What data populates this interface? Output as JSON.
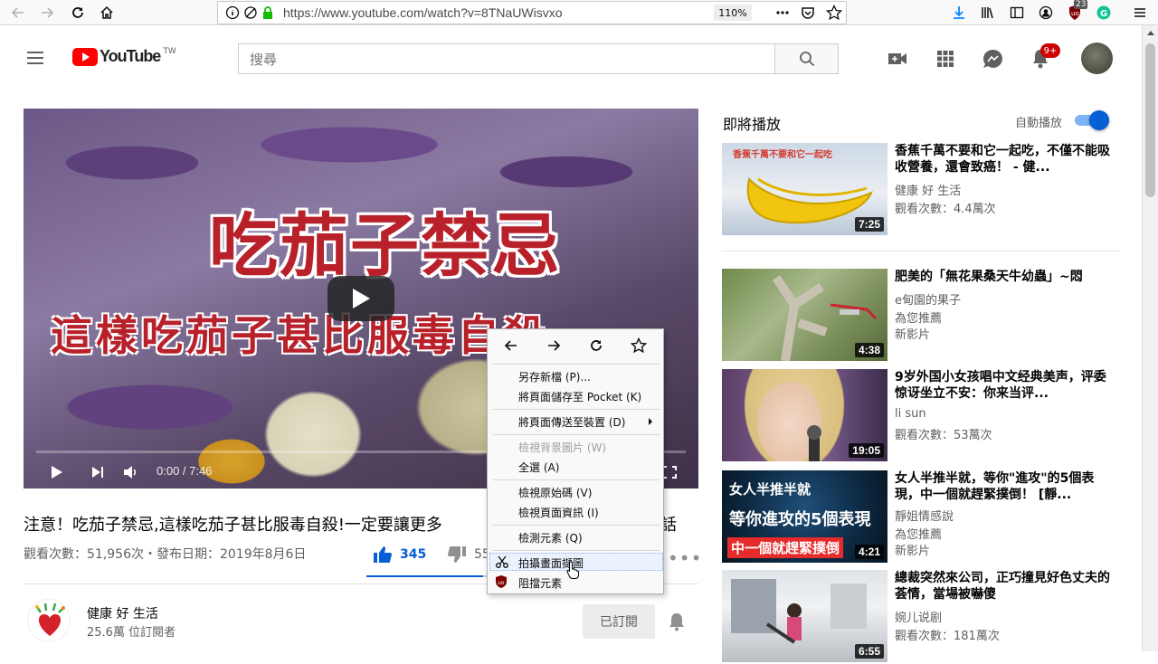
{
  "browser": {
    "url": "https://www.youtube.com/watch?v=8TNaUWisvxo",
    "zoom": "110%",
    "extension_badge": "23"
  },
  "header": {
    "logo_text": "YouTube",
    "logo_region": "TW",
    "search_placeholder": "搜尋",
    "notification_count": "9+"
  },
  "video": {
    "art_title": "吃茄子禁忌",
    "art_subtitle": "這樣吃茄子甚比服毒自殺",
    "time": "0:00 / 7:46",
    "title": "注意！吃茄子禁忌,這樣吃茄子甚比服毒自殺!一定要讓更多",
    "title_tail": "話",
    "meta": "觀看次數：51,956次・發布日期：2019年8月6日",
    "likes": "345",
    "dislikes": "55",
    "like_ratio": 0.86
  },
  "channel": {
    "name": "健康 好 生活",
    "subscribers": "25.6萬 位訂閱者",
    "subscribe_label": "已訂閱"
  },
  "sidebar": {
    "up_next": "即將播放",
    "autoplay_label": "自動播放",
    "autoplay_on": true,
    "items": [
      {
        "title": "香蕉千萬不要和它一起吃，不僅不能吸收營養，還會致癌！ - 健...",
        "channel": "健康 好 生活",
        "views": "觀看次數：4.4萬次",
        "duration": "7:25",
        "thumb_text": "香蕉千萬不要和它一起吃"
      },
      {
        "title": "肥美的「無花果桑天牛幼蟲」~悶",
        "channel": "e甸園的果子",
        "views": "為您推薦",
        "extra": "新影片",
        "duration": "4:38"
      },
      {
        "title": "9岁外国小女孩唱中文经典美声，评委惊讶坐立不安：你来当评...",
        "channel": "li sun",
        "views": "觀看次數：53萬次",
        "duration": "19:05"
      },
      {
        "title": "女人半推半就，等你\"進攻\"的5個表現，中一個就趕緊撲倒！ [靜...",
        "channel": "靜姐情感說",
        "views": "為您推薦",
        "extra": "新影片",
        "duration": "4:21",
        "thumb_line1": "女人半推半就",
        "thumb_line2": "等你進攻的5個表現",
        "thumb_line3": "中一個就趕緊撲倒"
      },
      {
        "title": "總裁突然來公司，正巧撞見好色丈夫的荟情，當場被嚇傻",
        "channel": "婉儿说剧",
        "views": "觀看次數：181萬次",
        "duration": "6:55"
      }
    ]
  },
  "context_menu": {
    "items": [
      {
        "label": "另存新檔 (P)...",
        "disabled": false
      },
      {
        "label": "將頁面儲存至 Pocket (K)",
        "disabled": false
      },
      {
        "label": "將頁面傳送至裝置 (D)",
        "disabled": false
      },
      {
        "label": "檢視背景圖片 (W)",
        "disabled": true
      },
      {
        "label": "全選 (A)",
        "disabled": false
      },
      {
        "label": "檢視原始碼 (V)",
        "disabled": false
      },
      {
        "label": "檢視頁面資訊 (I)",
        "disabled": false
      },
      {
        "label": "檢測元素 (Q)",
        "disabled": false
      },
      {
        "label": "拍攝畫面擷圖",
        "disabled": false
      },
      {
        "label": "阻擋元素",
        "disabled": false
      }
    ]
  },
  "colors": {
    "youtube_red": "#ff0000",
    "accent_blue": "#065fd4",
    "firefox_green": "#12bc00"
  }
}
